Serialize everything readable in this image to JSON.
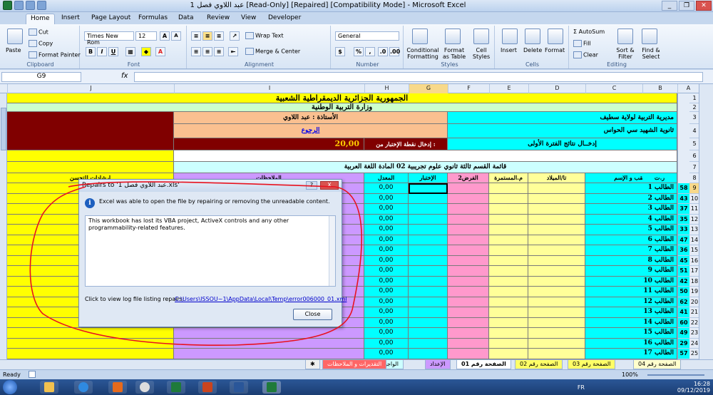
{
  "window": {
    "title": "عبد اللاوي فصل 1 [Read-Only] [Repaired] [Compatibility Mode] - Microsoft Excel",
    "controls": [
      "_",
      "❐",
      "✕"
    ]
  },
  "ribbon_tabs": [
    "Home",
    "Insert",
    "Page Layout",
    "Formulas",
    "Data",
    "Review",
    "View",
    "Developer"
  ],
  "ribbon": {
    "clipboard": {
      "label": "Clipboard",
      "paste": "Paste",
      "cut": "Cut",
      "copy": "Copy",
      "format_painter": "Format Painter"
    },
    "font": {
      "label": "Font",
      "name": "Times New Rom",
      "size": "12",
      "grow": "A",
      "shrink": "A",
      "bold": "B",
      "italic": "I",
      "underline": "U"
    },
    "alignment": {
      "label": "Alignment",
      "wrap": "Wrap Text",
      "merge": "Merge & Center"
    },
    "number": {
      "label": "Number",
      "format": "General",
      "pct": "%",
      "comma": ","
    },
    "styles": {
      "label": "Styles",
      "conditional": "Conditional Formatting",
      "as_table": "Format as Table",
      "cell_styles": "Cell Styles"
    },
    "cells": {
      "label": "Cells",
      "insert": "Insert",
      "delete": "Delete",
      "format": "Format"
    },
    "editing": {
      "label": "Editing",
      "autosum": "AutoSum",
      "fill": "Fill",
      "clear": "Clear",
      "sort": "Sort & Filter",
      "find": "Find & Select"
    }
  },
  "formula_bar": {
    "name_box": "G9",
    "fx": "fx",
    "value": ""
  },
  "columns": [
    "J",
    "I",
    "H",
    "G",
    "F",
    "E",
    "D",
    "C",
    "B",
    "A"
  ],
  "rows": [
    "1",
    "2",
    "3",
    "4",
    "5",
    "6",
    "7",
    "8",
    "9",
    "10",
    "11",
    "12",
    "13",
    "14",
    "15",
    "16",
    "17",
    "18",
    "19",
    "20",
    "21",
    "22",
    "23",
    "24",
    "25"
  ],
  "sheet": {
    "title1": "الجمهورية الجزائرية الديمقراطية الشعبية",
    "title2": "وزارة التربية الوطنية",
    "directorate": "مديرية التربية لولاية سطيف",
    "school": "ثانوية الشهيد سي الحواس",
    "teacher": "الأستاذة : عبد اللاوي",
    "back_link": "الرجوع",
    "entry_label": "إدخال نقطة الإختبار من :",
    "entry_value": "20,00",
    "period": "إدخــال نتائج  الفترة الأولى",
    "class_line": "قائمة القسم  ثالثة ثانوي علوم تجريبية 02  المادة اللغة العربية",
    "headers": {
      "rank": "ر.ت",
      "name": "اللقب و الإسم",
      "birth": "تا/الميلاد",
      "cont": "م.المستمرة",
      "assign": "الفرض2",
      "exam": "الإختبار",
      "avg": "المعدل",
      "notes": "الملاحظات",
      "advice": "ارشادات للتحسن"
    },
    "students": [
      {
        "n": "58",
        "name": "الطالب 1",
        "avg": "0,00"
      },
      {
        "n": "43",
        "name": "الطالب 2",
        "avg": "0,00"
      },
      {
        "n": "37",
        "name": "الطالب 3",
        "avg": "0,00"
      },
      {
        "n": "35",
        "name": "الطالب 4",
        "avg": "0,00"
      },
      {
        "n": "33",
        "name": "الطالب 5",
        "avg": "0,00"
      },
      {
        "n": "47",
        "name": "الطالب 6",
        "avg": "0,00"
      },
      {
        "n": "36",
        "name": "الطالب 7",
        "avg": "0,00"
      },
      {
        "n": "45",
        "name": "الطالب 8",
        "avg": "0,00"
      },
      {
        "n": "51",
        "name": "الطالب 9",
        "avg": "0,00"
      },
      {
        "n": "42",
        "name": "الطالب 10",
        "avg": "0,00"
      },
      {
        "n": "50",
        "name": "الطالب 11",
        "avg": "0,00"
      },
      {
        "n": "62",
        "name": "الطالب 12",
        "avg": "0,00"
      },
      {
        "n": "41",
        "name": "الطالب 13",
        "avg": "0,00"
      },
      {
        "n": "60",
        "name": "الطالب 14",
        "avg": "0,00"
      },
      {
        "n": "49",
        "name": "الطالب 15",
        "avg": "0,00"
      },
      {
        "n": "29",
        "name": "الطالب 16",
        "avg": "0,00"
      },
      {
        "n": "57",
        "name": "الطالب 17",
        "avg": "0,00"
      }
    ]
  },
  "dialog": {
    "title": "Repairs to '1 عبد اللاوي فصل.xls'",
    "help": "?",
    "close_x": "X",
    "message": "Excel was able to open the file by repairing or removing the unreadable content.",
    "detail": "This workbook has lost its VBA project, ActiveX controls and any other programmability-related features.",
    "log_label": "Click to view log file listing repairs:",
    "log_path": "C:\\Users\\ISSOU~1\\AppData\\Local\\Temp\\error006000_01.xml",
    "close_button": "Close"
  },
  "sheet_tabs": [
    "الصفحة رقم 04",
    "الصفحة رقم 03",
    "الصفحة رقم 02",
    "الصفحة رقم 01",
    "الإعداد",
    "الواجهة",
    "التقديرات و الملاحظات"
  ],
  "status": {
    "ready": "Ready",
    "zoom": "100%"
  },
  "taskbar": {
    "lang": "FR",
    "time": "16:28",
    "date": "09/12/2019"
  },
  "colors": {
    "yellow": "#ffff00",
    "cyan": "#00ffff",
    "pink": "#ff99cc",
    "lavender": "#cc99ff",
    "darkred": "#800000",
    "peach": "#fac090",
    "lightgreen": "#ccffcc",
    "lightyellow": "#ffff99",
    "annotation_red": "#e8121f"
  }
}
